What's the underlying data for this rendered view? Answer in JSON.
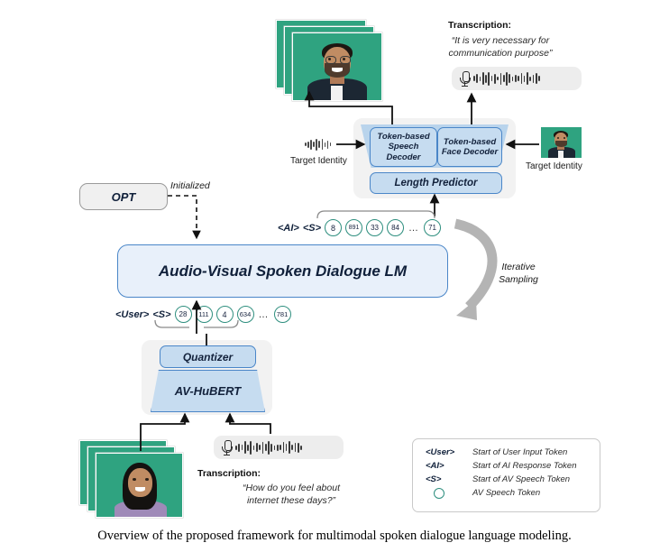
{
  "figure": {
    "caption": "Overview of the proposed framework for multimodal spoken dialogue language modeling."
  },
  "output": {
    "video_label": "output-face-video",
    "transcription_title": "Transcription:",
    "transcription_line1": "“It is very necessary for",
    "transcription_line2": "communication purpose”"
  },
  "decoders": {
    "speech_decoder_line1": "Token-based",
    "speech_decoder_line2": "Speech Decoder",
    "face_decoder_line1": "Token-based",
    "face_decoder_line2": "Face Decoder",
    "length_predictor": "Length Predictor",
    "target_identity_left": "Target Identity",
    "target_identity_right": "Target Identity"
  },
  "opt": {
    "label": "OPT",
    "init_label": "Initialized"
  },
  "lm": {
    "label": "Audio-Visual Spoken Dialogue LM",
    "iterative_line1": "Iterative",
    "iterative_line2": "Sampling"
  },
  "ai_sequence": {
    "prefix1": "<AI>",
    "prefix2": "<S>",
    "tokens": [
      "8",
      "891",
      "33",
      "84"
    ],
    "ellipsis": "…",
    "last_token": "71"
  },
  "user_sequence": {
    "prefix1": "<User>",
    "prefix2": "<S>",
    "tokens": [
      "28",
      "111",
      "4",
      "634"
    ],
    "ellipsis": "…",
    "last_token": "781"
  },
  "encoder": {
    "quantizer": "Quantizer",
    "av_hubert": "AV-HuBERT"
  },
  "input": {
    "video_label": "input-face-video",
    "transcription_title": "Transcription:",
    "transcription_line1": "“How do you feel about",
    "transcription_line2": "internet these days?”"
  },
  "legend": {
    "rows": [
      {
        "key": "<User>",
        "value": "Start of User Input Token"
      },
      {
        "key": "<AI>",
        "value": "Start of AI Response Token"
      },
      {
        "key": "<S>",
        "value": "Start of AV Speech Token"
      },
      {
        "key": "",
        "value": "AV Speech Token"
      }
    ]
  },
  "colors": {
    "video_green": "#2fa380",
    "box_blue_fill": "#c6dcf0",
    "box_blue_border": "#4a86c8",
    "lm_fill": "#e8f0fa",
    "token_circle": "#2f8f7f",
    "panel_grey": "#f2f2f2",
    "arrow_grey": "#b4b4b4"
  }
}
